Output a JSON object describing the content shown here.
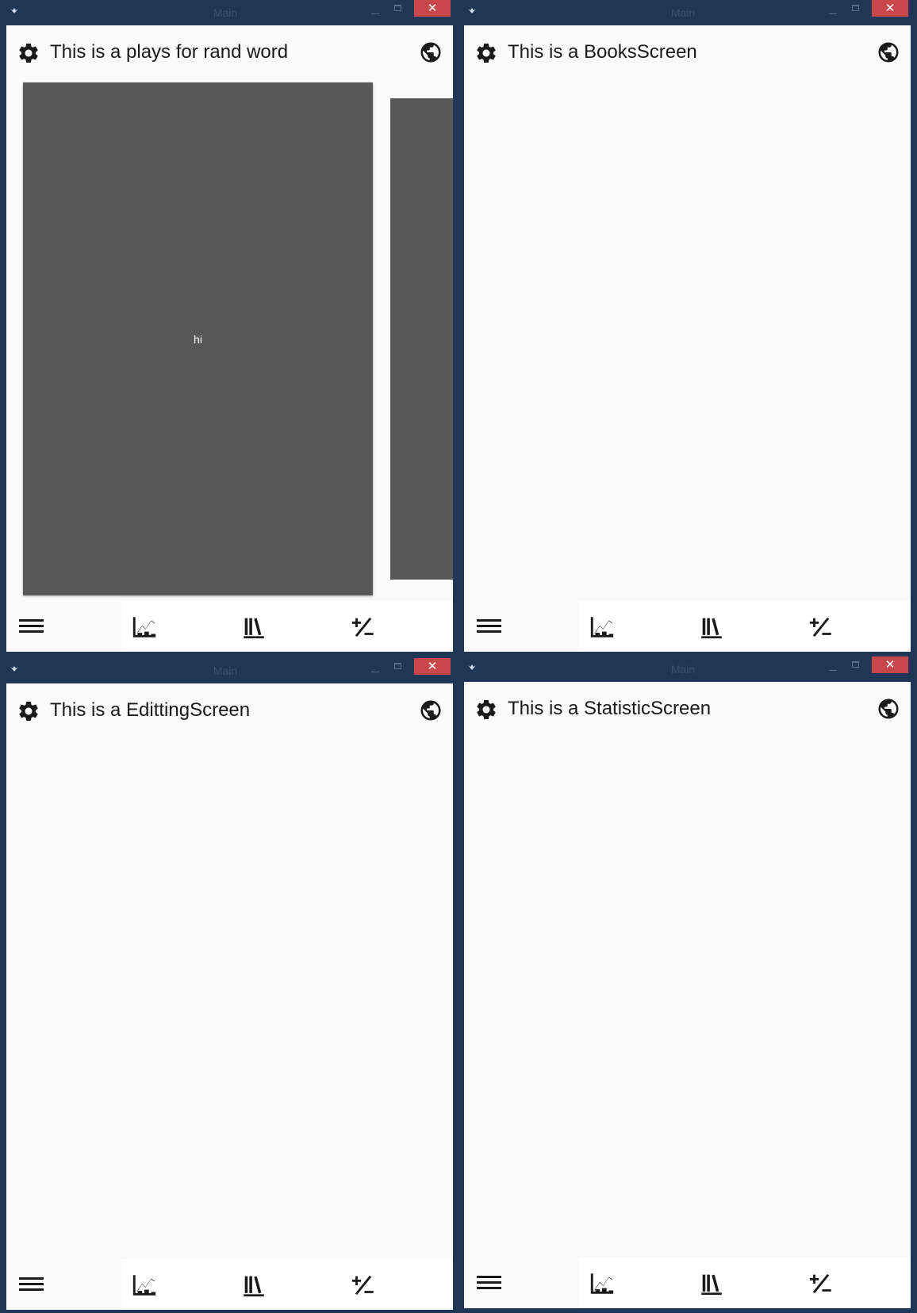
{
  "window_title": "Main",
  "close_glyph": "✕",
  "colors": {
    "titlebar": "#1f3656",
    "close_button": "#c7474a",
    "card": "#585858",
    "background": "#fafafa"
  },
  "icons": {
    "settings": "gear-icon",
    "language": "globe-icon",
    "menu": "hamburger-icon",
    "statistics": "chart-icon",
    "books": "library-icon",
    "edit": "plus-minus-icon"
  },
  "windows": [
    {
      "title": "This is a plays for rand word",
      "card_text": "hi"
    },
    {
      "title": "This is a BooksScreen"
    },
    {
      "title": "This is a EdittingScreen"
    },
    {
      "title": "This is a StatisticScreen"
    }
  ]
}
